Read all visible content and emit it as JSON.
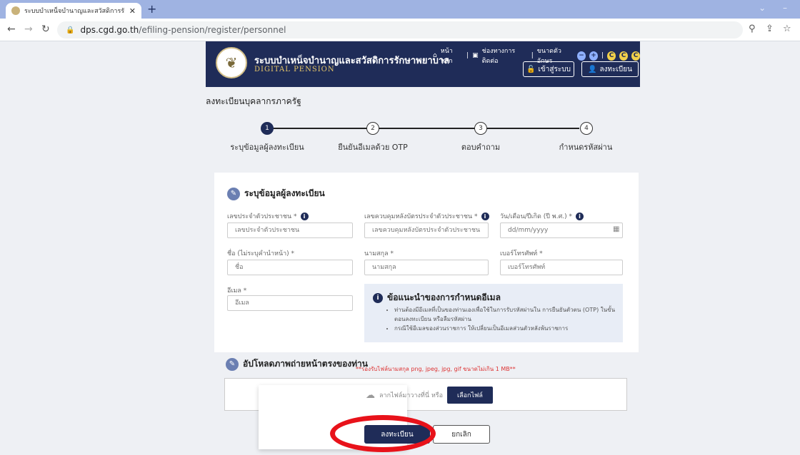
{
  "browser": {
    "tab_title": "ระบบบำเหน็จบำนาญและสวัสดิการรักษ",
    "url_host": "dps.cgd.go.th",
    "url_path": "/efiling-pension/register/personnel"
  },
  "header": {
    "site_title": "ระบบบำเหน็จบำนาญและสวัสดิการรักษาพยาบาล",
    "site_subtitle": "DIGITAL PENSION",
    "links": {
      "home": "หน้าหลัก",
      "manual": "ช่องทางการติดต่อ",
      "font_size": "ขนาดตัวอักษร"
    },
    "login_label": "เข้าสู่ระบบ",
    "register_label": "ลงทะเบียน"
  },
  "page": {
    "title": "ลงทะเบียนบุคลากรภาครัฐ",
    "steps": [
      {
        "num": "1",
        "label": "ระบุข้อมูลผู้ลงทะเบียน"
      },
      {
        "num": "2",
        "label": "ยืนยันอีเมลด้วย OTP"
      },
      {
        "num": "3",
        "label": "ตอบคำถาม"
      },
      {
        "num": "4",
        "label": "กำหนดรหัสผ่าน"
      }
    ]
  },
  "form": {
    "section_title": "ระบุข้อมูลผู้ลงทะเบียน",
    "id_card": {
      "label": "เลขประจำตัวประชาชน *",
      "placeholder": "เลขประจำตัวประชาชน"
    },
    "laser": {
      "label": "เลขควบคุมหลังบัตรประจำตัวประชาชน *",
      "placeholder": "เลขควบคุมหลังบัตรประจำตัวประชาชน"
    },
    "birth": {
      "label": "วัน/เดือน/ปีเกิด (ปี พ.ศ.) *",
      "placeholder": "dd/mm/yyyy"
    },
    "name": {
      "label": "ชื่อ (ไม่ระบุคำนำหน้า) *",
      "placeholder": "ชื่อ"
    },
    "surname": {
      "label": "นามสกุล *",
      "placeholder": "นามสกุล"
    },
    "phone": {
      "label": "เบอร์โทรศัพท์ *",
      "placeholder": "เบอร์โทรศัพท์"
    },
    "email": {
      "label": "อีเมล *",
      "placeholder": "อีเมล"
    }
  },
  "advice": {
    "title": "ข้อแนะนำของการกำหนดอีเมล",
    "items": [
      "ท่านต้องมีอีเมลที่เป็นของท่านเองเพื่อใช้ในการรับรหัสผ่านใน การยืนยันตัวตน (OTP) ในขั้นตอนลงทะเบียน หรือลืมรหัสผ่าน",
      "กรณีใช้อีเมลของส่วนราชการ ให้เปลี่ยนเป็นอีเมลส่วนตัวหลังพ้นราชการ"
    ]
  },
  "upload": {
    "title": "อัปโหลดภาพถ่ายหน้าตรงของท่าน",
    "note": "**รองรับไฟล์นามสกุล png, jpeg, jpg, gif ขนาดไม่เกิน 1 MB**",
    "drop_text": "ลากไฟล์มาวางที่นี่ หรือ",
    "choose_label": "เลือกไฟล์"
  },
  "actions": {
    "register": "ลงทะเบียน",
    "cancel": "ยกเลิก"
  },
  "colors": {
    "primary": "#1f2c58",
    "highlight": "#e8121a",
    "tabbar": "#9fb3e2"
  }
}
